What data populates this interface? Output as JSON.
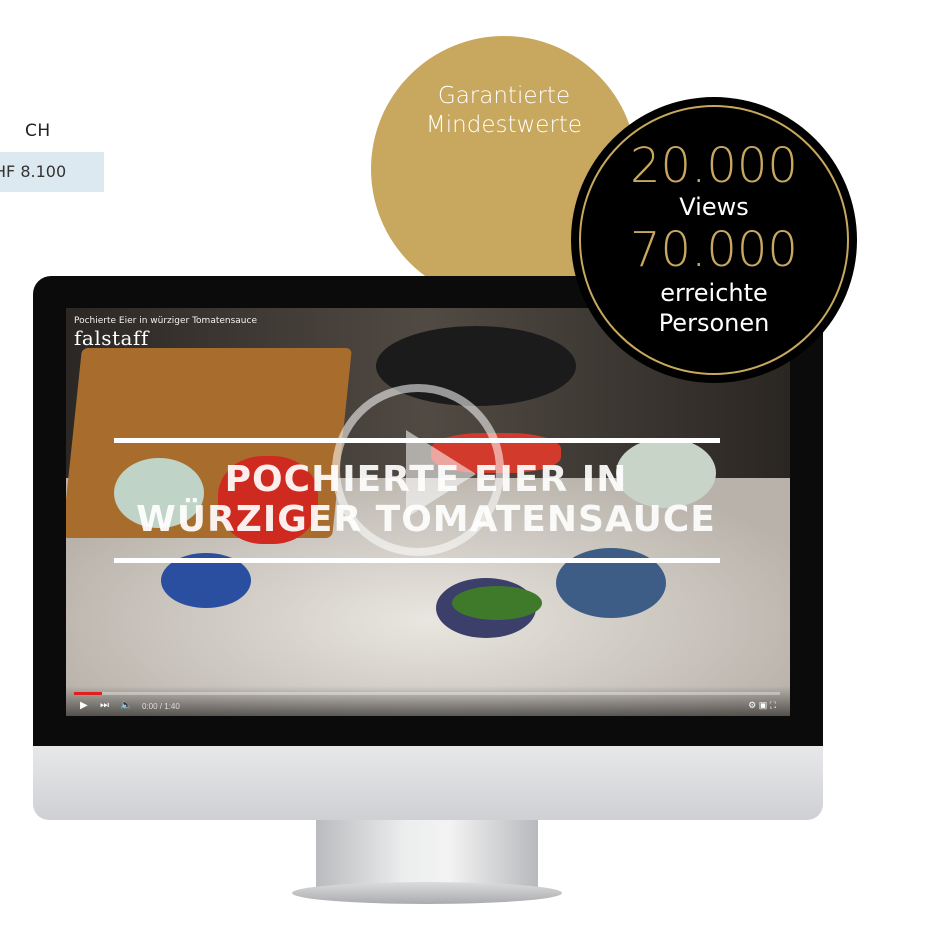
{
  "price": {
    "currency_code": "CH",
    "amount": "HF 8.100"
  },
  "badge_gold": {
    "line1": "Garantierte",
    "line2": "Mindestwerte",
    "color": "#c8a85e"
  },
  "badge_stats": {
    "views_value": "20.000",
    "views_label": "Views",
    "reach_value": "70.000",
    "reach_label_1": "erreichte",
    "reach_label_2": "Personen",
    "accent": "#c8a85e"
  },
  "video": {
    "title": "Pochierte Eier in würziger Tomatensauce",
    "brand": "falstaff",
    "overlay_line1": "POCHIERTE EIER IN",
    "overlay_line2": "WÜRZIGER TOMATENSAUCE",
    "progress": 0.04,
    "time": "0:00 / 1:40",
    "icons": [
      "play-icon",
      "next-icon",
      "volume-icon",
      "settings-icon",
      "youtube-icon",
      "fullscreen-icon"
    ]
  }
}
